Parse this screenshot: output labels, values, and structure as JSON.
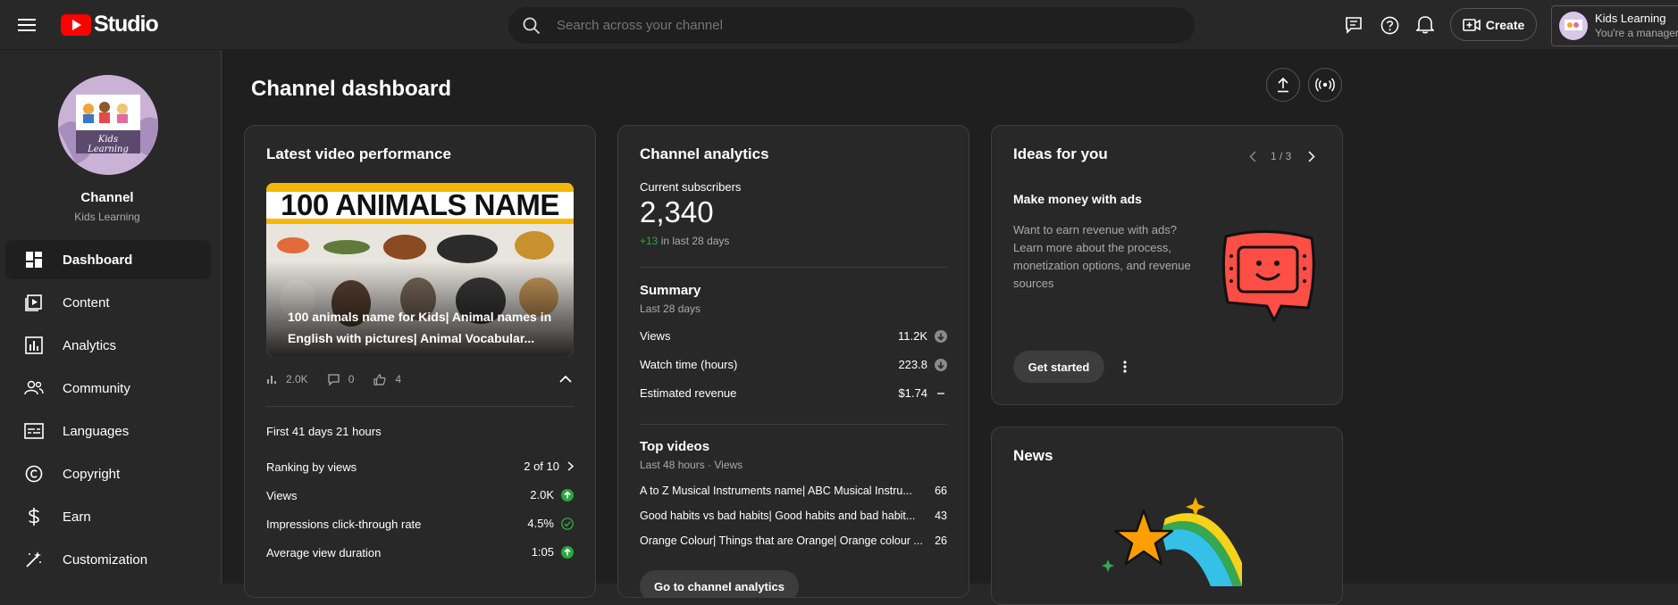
{
  "header": {
    "logo_text": "Studio",
    "search_placeholder": "Search across your channel",
    "create_label": "Create",
    "account_name": "Kids Learning",
    "account_role": "You're a manager"
  },
  "sidebar": {
    "channel_label": "Channel",
    "channel_name": "Kids Learning",
    "avatar_caption": "Kids Learning",
    "items": [
      {
        "label": "Dashboard",
        "icon": "dashboard-icon"
      },
      {
        "label": "Content",
        "icon": "content-icon"
      },
      {
        "label": "Analytics",
        "icon": "analytics-icon"
      },
      {
        "label": "Community",
        "icon": "community-icon"
      },
      {
        "label": "Languages",
        "icon": "languages-icon"
      },
      {
        "label": "Copyright",
        "icon": "copyright-icon"
      },
      {
        "label": "Earn",
        "icon": "earn-icon"
      },
      {
        "label": "Customization",
        "icon": "customization-icon"
      }
    ]
  },
  "page": {
    "title": "Channel dashboard"
  },
  "latest_video": {
    "title": "Latest video performance",
    "thumb_banner": "100 ANIMALS NAME",
    "video_title": "100 animals name for Kids| Animal names in English with pictures| Animal Vocabular...",
    "views": "2.0K",
    "comments": "0",
    "likes": "4",
    "period": "First 41 days 21 hours",
    "rows": [
      {
        "label": "Ranking by views",
        "value": "2 of 10"
      },
      {
        "label": "Views",
        "value": "2.0K"
      },
      {
        "label": "Impressions click-through rate",
        "value": "4.5%"
      },
      {
        "label": "Average view duration",
        "value": "1:05"
      }
    ]
  },
  "analytics": {
    "title": "Channel analytics",
    "subs_label": "Current subscribers",
    "subs_value": "2,340",
    "subs_delta": "+13",
    "subs_period": "in last 28 days",
    "summary_title": "Summary",
    "summary_period": "Last 28 days",
    "summary_rows": [
      {
        "label": "Views",
        "value": "11.2K"
      },
      {
        "label": "Watch time (hours)",
        "value": "223.8"
      },
      {
        "label": "Estimated revenue",
        "value": "$1.74"
      }
    ],
    "top_title": "Top videos",
    "top_period": "Last 48 hours · Views",
    "top_videos": [
      {
        "title": "A to Z Musical Instruments name| ABC Musical Instru...",
        "views": "66"
      },
      {
        "title": "Good habits vs bad habits| Good habits and bad habit...",
        "views": "43"
      },
      {
        "title": "Orange Colour| Things that are Orange| Orange colour ...",
        "views": "26"
      }
    ],
    "button_label": "Go to channel analytics"
  },
  "ideas": {
    "title": "Ideas for you",
    "pager": "1 / 3",
    "heading": "Make money with ads",
    "body": "Want to earn revenue with ads? Learn more about the process, monetization options, and revenue sources",
    "button_label": "Get started"
  },
  "news": {
    "title": "News"
  },
  "colors": {
    "accent_red": "#ff0000",
    "green": "#2ba640",
    "card_bg": "#282828",
    "page_bg": "#1f1f1f"
  }
}
